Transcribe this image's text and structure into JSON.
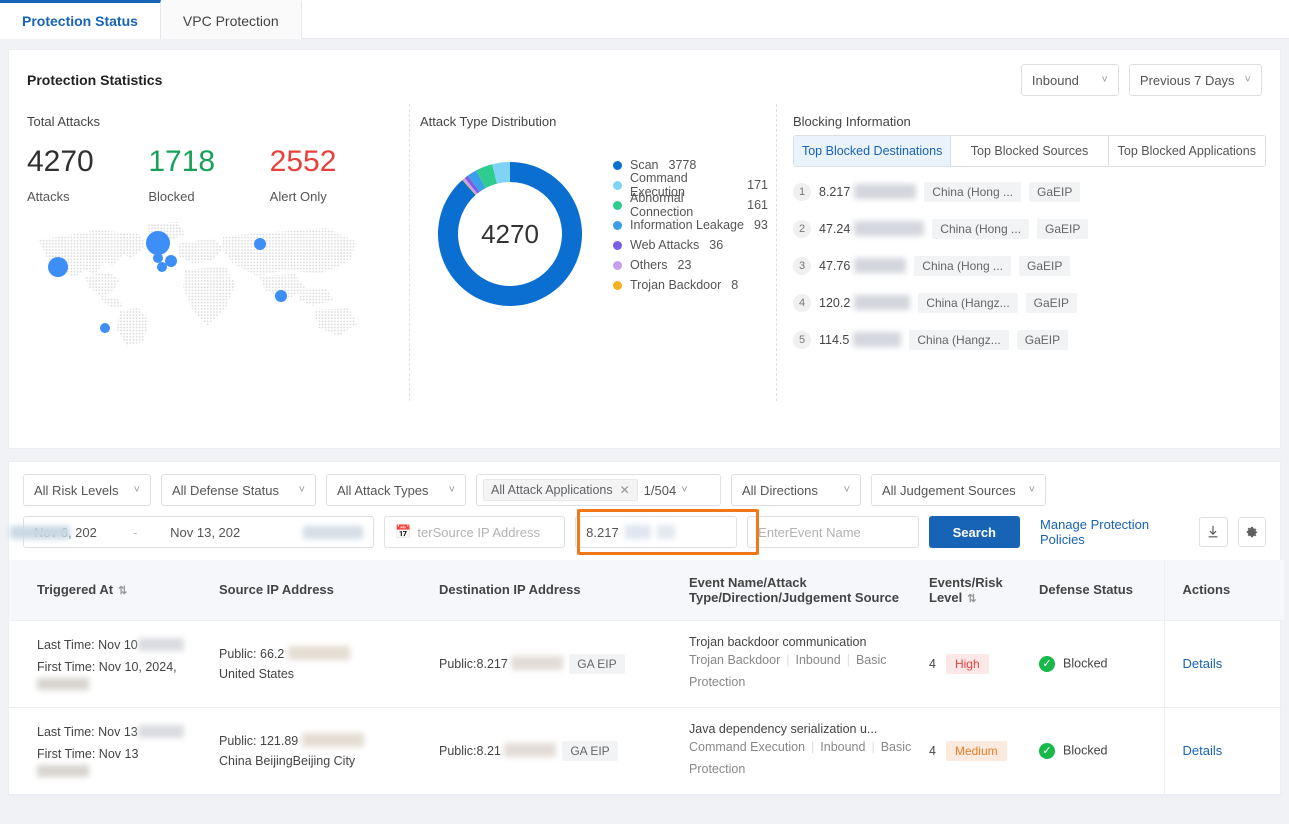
{
  "tabs": [
    {
      "label": "Protection Status",
      "active": true
    },
    {
      "label": "VPC Protection",
      "active": false
    }
  ],
  "stats": {
    "title": "Protection Statistics",
    "direction_filter": "Inbound",
    "time_filter": "Previous 7 Days",
    "total": {
      "panel_label": "Total Attacks",
      "items": [
        {
          "value": "4270",
          "label": "Attacks",
          "color": "#303030"
        },
        {
          "value": "1718",
          "label": "Blocked",
          "color": "#18a058"
        },
        {
          "value": "2552",
          "label": "Alert Only",
          "color": "#e8413c"
        }
      ]
    },
    "attack_type": {
      "panel_label": "Attack Type Distribution",
      "center_value": "4270"
    },
    "blocking": {
      "panel_label": "Blocking Information",
      "tabs": [
        {
          "label": "Top Blocked Destinations",
          "active": true
        },
        {
          "label": "Top Blocked Sources",
          "active": false
        },
        {
          "label": "Top Blocked Applications",
          "active": false
        }
      ],
      "rows": [
        {
          "rank": "1",
          "ip": "8.217",
          "region": "China (Hong ...",
          "type": "GaEIP"
        },
        {
          "rank": "2",
          "ip": "47.24",
          "region": "China (Hong ...",
          "type": "GaEIP"
        },
        {
          "rank": "3",
          "ip": "47.76",
          "region": "China (Hong ...",
          "type": "GaEIP"
        },
        {
          "rank": "4",
          "ip": "120.2",
          "region": "China (Hangz...",
          "type": "GaEIP"
        },
        {
          "rank": "5",
          "ip": "114.5",
          "region": "China (Hangz...",
          "type": "GaEIP"
        }
      ]
    }
  },
  "chart_data": {
    "type": "pie",
    "title": "Attack Type Distribution",
    "center_label": "4270",
    "legend_position": "right",
    "total": 4270,
    "categories": [
      "Scan",
      "Command Execution",
      "Abnormal Connection",
      "Information Leakage",
      "Web Attacks",
      "Others",
      "Trojan Backdoor"
    ],
    "values": [
      3778,
      171,
      161,
      93,
      36,
      23,
      8
    ],
    "colors": [
      "#0a6fd1",
      "#7fd4f5",
      "#2ecc8f",
      "#3a9fe8",
      "#7b5ee8",
      "#c79ef0",
      "#f5b220"
    ]
  },
  "filters": {
    "risk_levels": "All Risk Levels",
    "defense_status": "All Defense Status",
    "attack_types": "All Attack Types",
    "attack_applications_chip": "All Attack Applications",
    "page_indicator": "1/504",
    "directions": "All Directions",
    "judgement_sources": "All Judgement Sources",
    "date_start": "Nov 6, 202",
    "date_sep": "-",
    "date_end": "Nov 13, 202",
    "source_ip_placeholder": "terSource IP Address",
    "dest_ip_value": "8.217",
    "event_name_placeholder": "EnterEvent Name",
    "search_label": "Search",
    "manage_policies": "Manage Protection Policies"
  },
  "table": {
    "columns": [
      {
        "label": "Triggered At",
        "sortable": true
      },
      {
        "label": "Source IP Address",
        "sortable": false
      },
      {
        "label": "Destination IP Address",
        "sortable": false
      },
      {
        "label": "Event Name/Attack Type/Direction/Judgement Source",
        "line1": "Event Name/Attack",
        "line2": "Type/Direction/Judgement Source",
        "sortable": false
      },
      {
        "label": "Events/Risk Level",
        "line1": "Events/Risk",
        "line2": "Level",
        "sortable": true
      },
      {
        "label": "Defense Status",
        "sortable": false
      },
      {
        "label": "Actions",
        "sortable": false
      }
    ],
    "rows": [
      {
        "last_time": "Last Time: Nov 10",
        "first_time": "First Time: Nov 10, 2024,",
        "src_ip": "Public: 66.2",
        "src_geo": "United States",
        "dst_ip": "Public:8.217",
        "dst_tag": "GA EIP",
        "event_name": "Trojan backdoor communication",
        "attack_type": "Trojan Backdoor",
        "direction": "Inbound",
        "judgement": "Basic Protection",
        "events": "4",
        "risk": "High",
        "risk_style": "high",
        "defense": "Blocked",
        "action": "Details"
      },
      {
        "last_time": "Last Time: Nov 13",
        "first_time": "First Time: Nov 13",
        "src_ip": "Public: 121.89",
        "src_geo": "China  BeijingBeijing City",
        "dst_ip": "Public:8.21",
        "dst_tag": "GA EIP",
        "event_name": "Java dependency serialization u...",
        "attack_type": "Command Execution",
        "direction": "Inbound",
        "judgement": "Basic Protection",
        "events": "4",
        "risk": "Medium",
        "risk_style": "medium",
        "defense": "Blocked",
        "action": "Details"
      }
    ]
  },
  "icons": {
    "calendar": "calendar-icon",
    "download": "download-icon",
    "settings": "gear-icon"
  },
  "colors": {
    "accent": "#1763b6",
    "highlight_box": "#f07818",
    "blocked_green": "#18a058",
    "alert_red": "#e8413c"
  }
}
